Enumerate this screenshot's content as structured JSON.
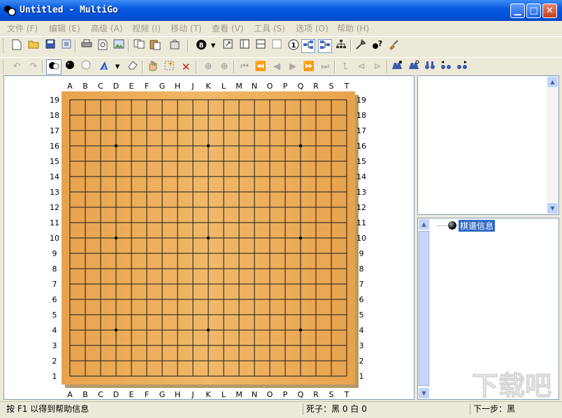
{
  "window": {
    "title": "Untitled - MultiGo",
    "min_symbol": "▁",
    "max_symbol": "□",
    "close_symbol": "✕"
  },
  "menu": [
    {
      "label": "文件",
      "key": "(F)"
    },
    {
      "label": "编辑",
      "key": "(E)"
    },
    {
      "label": "高级",
      "key": "(A)"
    },
    {
      "label": "视频",
      "key": "(I)"
    },
    {
      "label": "移动",
      "key": "(T)"
    },
    {
      "label": "查看",
      "key": "(V)"
    },
    {
      "label": "工具",
      "key": "(S)"
    },
    {
      "label": "选项",
      "key": "(O)"
    },
    {
      "label": "帮助",
      "key": "(H)"
    }
  ],
  "board": {
    "size": 19,
    "columns": [
      "A",
      "B",
      "C",
      "D",
      "E",
      "F",
      "G",
      "H",
      "J",
      "K",
      "L",
      "M",
      "N",
      "O",
      "P",
      "Q",
      "R",
      "S",
      "T"
    ],
    "rows": [
      "19",
      "18",
      "17",
      "16",
      "15",
      "14",
      "13",
      "12",
      "11",
      "10",
      "9",
      "8",
      "7",
      "6",
      "5",
      "4",
      "3",
      "2",
      "1"
    ],
    "star_points": [
      [
        4,
        4
      ],
      [
        4,
        10
      ],
      [
        4,
        16
      ],
      [
        10,
        4
      ],
      [
        10,
        10
      ],
      [
        10,
        16
      ],
      [
        16,
        4
      ],
      [
        16,
        10
      ],
      [
        16,
        16
      ]
    ],
    "colors": {
      "wood": "#e8a24c",
      "wood_light": "#f0b868",
      "line": "#1a1a1a",
      "shadow": "#b69a6a"
    }
  },
  "tree": {
    "root_label": "棋谱信息"
  },
  "status": {
    "help": "按 F1 以得到帮助信息",
    "captured": "死子：黑 0 白 0",
    "next": "下一步：黑"
  },
  "watermark": {
    "text": "下载吧"
  },
  "colors": {
    "titlebar": "#0a5be0",
    "selection": "#316ac5",
    "chrome": "#ece9d8"
  }
}
